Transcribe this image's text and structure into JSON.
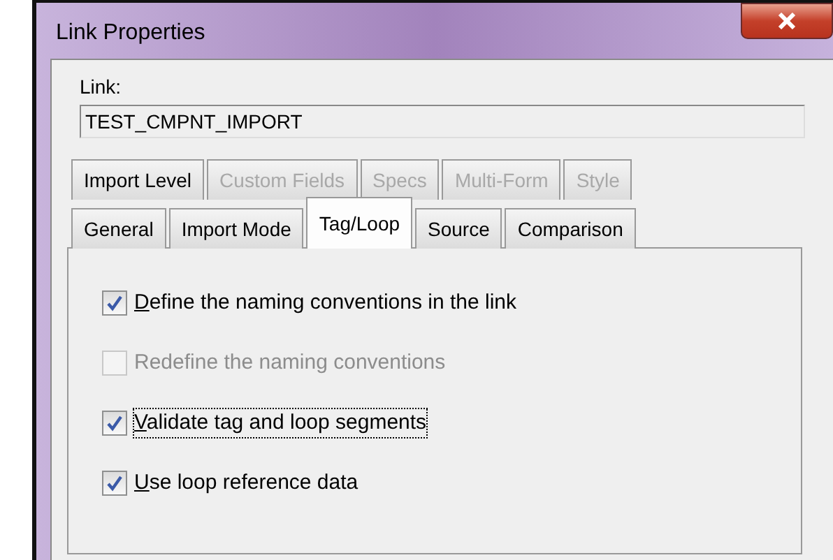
{
  "window": {
    "title": "Link Properties"
  },
  "link": {
    "label": "Link:",
    "value": "TEST_CMPNT_IMPORT"
  },
  "tab_rows": [
    {
      "tabs": [
        {
          "label": "Import Level",
          "selected": false,
          "disabled": false
        },
        {
          "label": "Custom Fields",
          "selected": false,
          "disabled": true
        },
        {
          "label": "Specs",
          "selected": false,
          "disabled": true
        },
        {
          "label": "Multi-Form",
          "selected": false,
          "disabled": true
        },
        {
          "label": "Style",
          "selected": false,
          "disabled": true
        }
      ]
    },
    {
      "tabs": [
        {
          "label": "General",
          "selected": false,
          "disabled": false
        },
        {
          "label": "Import Mode",
          "selected": false,
          "disabled": false
        },
        {
          "label": "Tag/Loop",
          "selected": true,
          "disabled": false
        },
        {
          "label": "Source",
          "selected": false,
          "disabled": false
        },
        {
          "label": "Comparison",
          "selected": false,
          "disabled": false
        }
      ]
    }
  ],
  "options": [
    {
      "label": "Define the naming conventions in the link",
      "checked": true,
      "disabled": false,
      "focused": false,
      "first_letter_underlined": true
    },
    {
      "label": "Redefine the naming conventions",
      "checked": false,
      "disabled": true,
      "focused": false,
      "first_letter_underlined": false
    },
    {
      "label": "Validate tag and loop segments",
      "checked": true,
      "disabled": false,
      "focused": true,
      "first_letter_underlined": true
    },
    {
      "label": "Use loop reference data",
      "checked": true,
      "disabled": false,
      "focused": false,
      "first_letter_underlined": true
    }
  ]
}
